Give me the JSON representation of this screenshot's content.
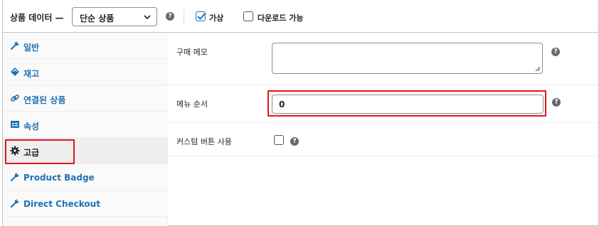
{
  "header": {
    "title": "상품 데이터 —",
    "product_type": "단순 상품",
    "help_glyph": "?",
    "virtual_label": "가상",
    "virtual_checked": true,
    "downloadable_label": "다운로드 가능",
    "downloadable_checked": false
  },
  "tabs": [
    {
      "label": "일반",
      "icon": "wrench-icon"
    },
    {
      "label": "재고",
      "icon": "tag-icon"
    },
    {
      "label": "연결된 상품",
      "icon": "link-icon"
    },
    {
      "label": "속성",
      "icon": "table-icon"
    },
    {
      "label": "고급",
      "icon": "gear-icon",
      "active": true
    },
    {
      "label": "Product Badge",
      "icon": "wrench-icon"
    },
    {
      "label": "Direct Checkout",
      "icon": "wrench-icon"
    }
  ],
  "fields": {
    "purchase_note_label": "구매 메모",
    "purchase_note_value": "",
    "menu_order_label": "메뉴 순서",
    "menu_order_value": "0",
    "custom_button_label": "커스텀 버튼 사용",
    "custom_button_checked": false
  },
  "colors": {
    "link": "#2271b1",
    "highlight": "#e0141e",
    "active_tab_bg": "#eeeeee"
  }
}
